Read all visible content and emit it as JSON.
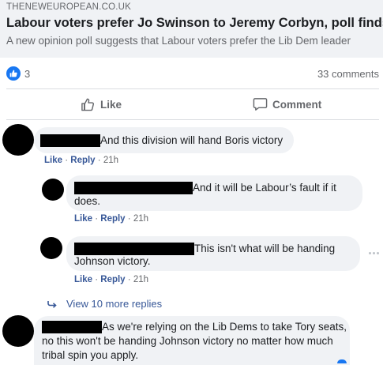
{
  "link": {
    "domain": "THENEWEUROPEAN.CO.UK",
    "headline": "Labour voters prefer Jo Swinson to Jeremy Corbyn, poll finds",
    "subline": "A new opinion poll suggests that Labour voters prefer the Lib Dem leader"
  },
  "stats": {
    "reaction_count": "3",
    "comments_count": "33 comments"
  },
  "actions": {
    "like": "Like",
    "comment": "Comment"
  },
  "comments": [
    {
      "text": "And this division will hand Boris victory",
      "like": "Like",
      "reply": "Reply",
      "sep": "·",
      "time": "21h"
    },
    {
      "text_line1": "And it will be Labour’s fault if it",
      "text_line2": "does.",
      "like": "Like",
      "reply": "Reply",
      "sep": "·",
      "time": "21h"
    },
    {
      "text_line1": "This isn't what will be handing",
      "text_line2": "Johnson victory.",
      "like": "Like",
      "reply": "Reply",
      "sep": "·",
      "time": "21h"
    },
    {
      "text_line1": "As we're relying on the Lib Dems to take Tory seats,",
      "text_line2": "no this won't be handing Johnson victory no matter how much",
      "text_line3": "tribal spin you apply."
    }
  ],
  "more_replies": "View 10 more replies",
  "colors": {
    "like_blue": "#1877f2",
    "link_blue": "#385898",
    "bubble_gray": "#f0f2f5",
    "secondary_text": "#65676b"
  }
}
